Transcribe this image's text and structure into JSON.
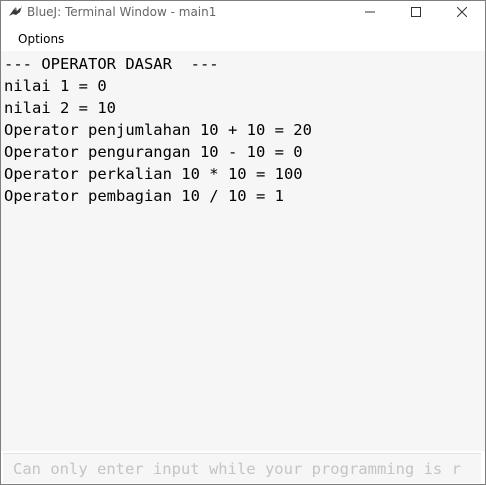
{
  "window": {
    "title": "BlueJ: Terminal Window - main1",
    "app_icon": "bluej-bird-icon",
    "controls": [
      "minimize-icon",
      "maximize-icon",
      "close-icon"
    ]
  },
  "menu": {
    "options_label": "Options"
  },
  "terminal": {
    "lines": [
      "--- OPERATOR DASAR  ---",
      "nilai 1 = 0",
      "nilai 2 = 10",
      "Operator penjumlahan 10 + 10 = 20",
      "Operator pengurangan 10 - 10 = 0",
      "Operator perkalian 10 * 10 = 100",
      "Operator pembagian 10 / 10 = 1"
    ]
  },
  "input": {
    "placeholder": "Can only enter input while your programming is r",
    "value": ""
  },
  "colors": {
    "terminal_bg": "#f6f6f6",
    "text": "#000000",
    "title_text": "#666666",
    "placeholder": "#c4c4c4"
  }
}
